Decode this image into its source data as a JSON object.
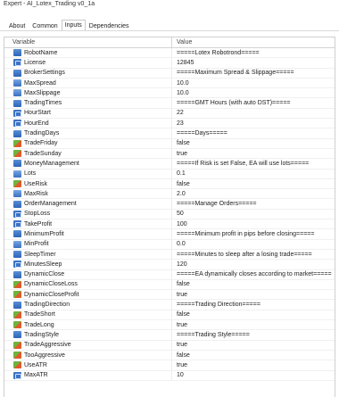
{
  "window": {
    "title": "Expert - AI_Lotex_Trading v0_1a"
  },
  "tabs": [
    {
      "label": "About"
    },
    {
      "label": "Common"
    },
    {
      "label": "Inputs"
    },
    {
      "label": "Dependencies"
    }
  ],
  "table": {
    "headers": {
      "variable": "Variable",
      "value": "Value"
    },
    "rows": [
      {
        "name": "RobotName",
        "value": "=====Lotex Robotrond=====",
        "icon": "separator-icon"
      },
      {
        "name": "License",
        "value": "12845",
        "icon": "number-icon"
      },
      {
        "name": "BrokerSettings",
        "value": "=====Maximum Spread & Slippage=====",
        "icon": "separator-icon"
      },
      {
        "name": "MaxSpread",
        "value": "10.0",
        "icon": "double-icon"
      },
      {
        "name": "MaxSlippage",
        "value": "10.0",
        "icon": "double-icon"
      },
      {
        "name": "TradingTimes",
        "value": "=====GMT Hours (with auto DST)=====",
        "icon": "separator-icon"
      },
      {
        "name": "HourStart",
        "value": "22",
        "icon": "number-icon"
      },
      {
        "name": "HourEnd",
        "value": "23",
        "icon": "number-icon"
      },
      {
        "name": "TradingDays",
        "value": "=====Days=====",
        "icon": "separator-icon"
      },
      {
        "name": "TradeFriday",
        "value": "false",
        "icon": "bool-icon"
      },
      {
        "name": "TradeSunday",
        "value": "true",
        "icon": "bool-icon"
      },
      {
        "name": "MoneyManagement",
        "value": "=====If Risk is set False, EA will use lots=====",
        "icon": "separator-icon"
      },
      {
        "name": "Lots",
        "value": "0.1",
        "icon": "double-icon"
      },
      {
        "name": "UseRisk",
        "value": "false",
        "icon": "bool-icon"
      },
      {
        "name": "MaxRisk",
        "value": "2.0",
        "icon": "double-icon"
      },
      {
        "name": "OrderManagement",
        "value": "=====Manage Orders=====",
        "icon": "separator-icon"
      },
      {
        "name": "StopLoss",
        "value": "50",
        "icon": "number-icon"
      },
      {
        "name": "TakeProfit",
        "value": "100",
        "icon": "number-icon"
      },
      {
        "name": "MinimumProfit",
        "value": "=====Minimum profit in pips before closing=====",
        "icon": "separator-icon"
      },
      {
        "name": "MinProfit",
        "value": "0.0",
        "icon": "double-icon"
      },
      {
        "name": "SleepTimer",
        "value": "=====Minutes to sleep after a losing trade=====",
        "icon": "separator-icon"
      },
      {
        "name": "MinutesSleep",
        "value": "120",
        "icon": "number-icon"
      },
      {
        "name": "DynamicClose",
        "value": "=====EA dynamically closes according to market=====",
        "icon": "separator-icon"
      },
      {
        "name": "DynamicCloseLoss",
        "value": "false",
        "icon": "bool-icon"
      },
      {
        "name": "DynamicCloseProfit",
        "value": "true",
        "icon": "bool-icon"
      },
      {
        "name": "TradingDirection",
        "value": "=====Trading Direction=====",
        "icon": "separator-icon"
      },
      {
        "name": "TradeShort",
        "value": "false",
        "icon": "bool-icon"
      },
      {
        "name": "TradeLong",
        "value": "true",
        "icon": "bool-icon"
      },
      {
        "name": "TradingStyle",
        "value": "=====Trading Style=====",
        "icon": "separator-icon"
      },
      {
        "name": "TradeAggressive",
        "value": "true",
        "icon": "bool-icon"
      },
      {
        "name": "TooAggressive",
        "value": "false",
        "icon": "bool-icon"
      },
      {
        "name": "UseATR",
        "value": "true",
        "icon": "bool-icon"
      },
      {
        "name": "MaxATR",
        "value": "10",
        "icon": "number-icon"
      }
    ]
  }
}
